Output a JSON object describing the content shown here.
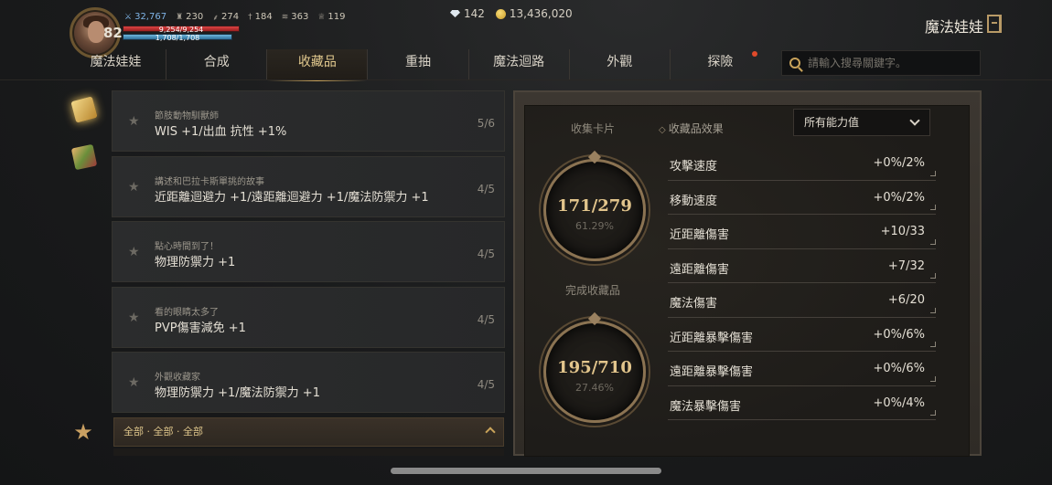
{
  "player": {
    "level": "82",
    "stats": [
      {
        "icon": "attack-power-icon",
        "value": "32,767"
      },
      {
        "icon": "defense-icon",
        "value": "230"
      },
      {
        "icon": "feather-icon",
        "value": "274"
      },
      {
        "icon": "dagger-icon",
        "value": "184"
      },
      {
        "icon": "wing-icon",
        "value": "363"
      },
      {
        "icon": "trophy-icon",
        "value": "119"
      }
    ],
    "hp": "9,254/9,254",
    "mp": "1,708/1,708"
  },
  "currency": {
    "diamonds": "142",
    "gold": "13,436,020"
  },
  "header": {
    "title": "魔法娃娃"
  },
  "tabs": [
    {
      "label": "魔法娃娃",
      "active": false,
      "dot": false
    },
    {
      "label": "合成",
      "active": false,
      "dot": false
    },
    {
      "label": "收藏品",
      "active": true,
      "dot": false
    },
    {
      "label": "重抽",
      "active": false,
      "dot": false
    },
    {
      "label": "魔法迴路",
      "active": false,
      "dot": false
    },
    {
      "label": "外觀",
      "active": false,
      "dot": false
    },
    {
      "label": "探險",
      "active": false,
      "dot": true
    }
  ],
  "search": {
    "placeholder": "請輸入搜尋關鍵字。"
  },
  "collections": [
    {
      "name": "節肢動物馴獸師",
      "effect": "WIS +1/出血 抗性 +1%",
      "progress": "5/6"
    },
    {
      "name": "講述和巴拉卡斯單挑的故事",
      "effect": "近距離迴避力 +1/遠距離迴避力 +1/魔法防禦力 +1",
      "progress": "4/5"
    },
    {
      "name": "點心時間到了！",
      "effect": "物理防禦力 +1",
      "progress": "4/5"
    },
    {
      "name": "看的眼睛太多了",
      "effect": "PVP傷害減免 +1",
      "progress": "4/5"
    },
    {
      "name": "外觀收藏家",
      "effect": "物理防禦力 +1/魔法防禦力 +1",
      "progress": "4/5"
    }
  ],
  "filter": {
    "label": "全部 · 全部 · 全部"
  },
  "summary": {
    "cards_label": "收集卡片",
    "cards_value": "171/279",
    "cards_pct": "61.29%",
    "completed_label": "完成收藏品",
    "completed_value": "195/710",
    "completed_pct": "27.46%"
  },
  "effects_panel": {
    "title": "收藏品效果",
    "select_value": "所有能力值",
    "rows": [
      {
        "name": "攻擊速度",
        "value": "+0%/2%"
      },
      {
        "name": "移動速度",
        "value": "+0%/2%"
      },
      {
        "name": "近距離傷害",
        "value": "+10/33"
      },
      {
        "name": "遠距離傷害",
        "value": "+7/32"
      },
      {
        "name": "魔法傷害",
        "value": "+6/20"
      },
      {
        "name": "近距離暴擊傷害",
        "value": "+0%/6%"
      },
      {
        "name": "遠距離暴擊傷害",
        "value": "+0%/6%"
      },
      {
        "name": "魔法暴擊傷害",
        "value": "+0%/4%"
      }
    ]
  },
  "colors": {
    "accent_gold": "#c9a35a",
    "hp_red": "#d44444",
    "mp_blue": "#6fb6dd",
    "notification_dot": "#e04a2a"
  }
}
